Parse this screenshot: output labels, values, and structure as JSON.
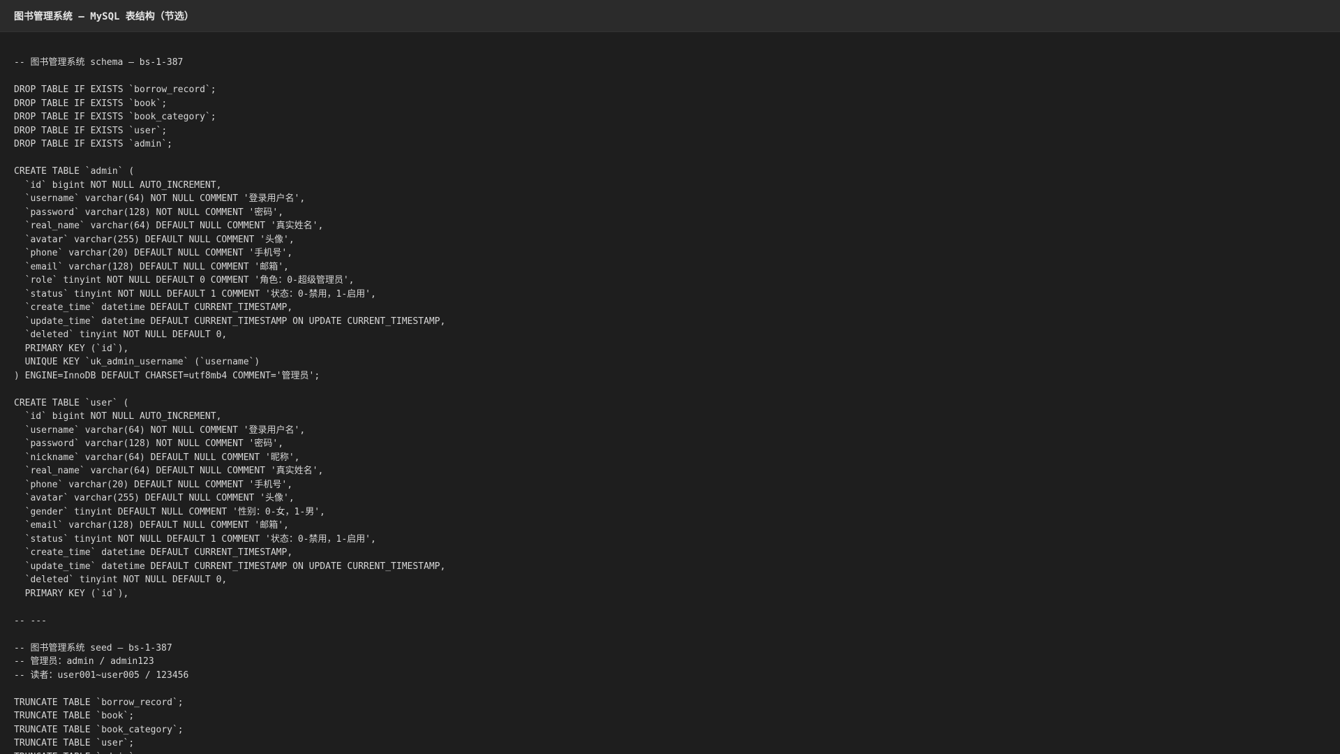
{
  "window": {
    "title": "图书管理系统 — MySQL 表结构（节选）"
  },
  "code": {
    "lines": [
      "-- 图书管理系统 schema — bs-1-387",
      "",
      "DROP TABLE IF EXISTS `borrow_record`;",
      "DROP TABLE IF EXISTS `book`;",
      "DROP TABLE IF EXISTS `book_category`;",
      "DROP TABLE IF EXISTS `user`;",
      "DROP TABLE IF EXISTS `admin`;",
      "",
      "CREATE TABLE `admin` (",
      "  `id` bigint NOT NULL AUTO_INCREMENT,",
      "  `username` varchar(64) NOT NULL COMMENT '登录用户名',",
      "  `password` varchar(128) NOT NULL COMMENT '密码',",
      "  `real_name` varchar(64) DEFAULT NULL COMMENT '真实姓名',",
      "  `avatar` varchar(255) DEFAULT NULL COMMENT '头像',",
      "  `phone` varchar(20) DEFAULT NULL COMMENT '手机号',",
      "  `email` varchar(128) DEFAULT NULL COMMENT '邮箱',",
      "  `role` tinyint NOT NULL DEFAULT 0 COMMENT '角色：0-超级管理员',",
      "  `status` tinyint NOT NULL DEFAULT 1 COMMENT '状态：0-禁用，1-启用',",
      "  `create_time` datetime DEFAULT CURRENT_TIMESTAMP,",
      "  `update_time` datetime DEFAULT CURRENT_TIMESTAMP ON UPDATE CURRENT_TIMESTAMP,",
      "  `deleted` tinyint NOT NULL DEFAULT 0,",
      "  PRIMARY KEY (`id`),",
      "  UNIQUE KEY `uk_admin_username` (`username`)",
      ") ENGINE=InnoDB DEFAULT CHARSET=utf8mb4 COMMENT='管理员';",
      "",
      "CREATE TABLE `user` (",
      "  `id` bigint NOT NULL AUTO_INCREMENT,",
      "  `username` varchar(64) NOT NULL COMMENT '登录用户名',",
      "  `password` varchar(128) NOT NULL COMMENT '密码',",
      "  `nickname` varchar(64) DEFAULT NULL COMMENT '昵称',",
      "  `real_name` varchar(64) DEFAULT NULL COMMENT '真实姓名',",
      "  `phone` varchar(20) DEFAULT NULL COMMENT '手机号',",
      "  `avatar` varchar(255) DEFAULT NULL COMMENT '头像',",
      "  `gender` tinyint DEFAULT NULL COMMENT '性别：0-女，1-男',",
      "  `email` varchar(128) DEFAULT NULL COMMENT '邮箱',",
      "  `status` tinyint NOT NULL DEFAULT 1 COMMENT '状态：0-禁用，1-启用',",
      "  `create_time` datetime DEFAULT CURRENT_TIMESTAMP,",
      "  `update_time` datetime DEFAULT CURRENT_TIMESTAMP ON UPDATE CURRENT_TIMESTAMP,",
      "  `deleted` tinyint NOT NULL DEFAULT 0,",
      "  PRIMARY KEY (`id`),",
      "",
      "-- ---",
      "",
      "-- 图书管理系统 seed — bs-1-387",
      "-- 管理员：admin / admin123",
      "-- 读者：user001~user005 / 123456",
      "",
      "TRUNCATE TABLE `borrow_record`;",
      "TRUNCATE TABLE `book`;",
      "TRUNCATE TABLE `book_category`;",
      "TRUNCATE TABLE `user`;",
      "TRUNCATE TABLE `admin`;"
    ]
  }
}
